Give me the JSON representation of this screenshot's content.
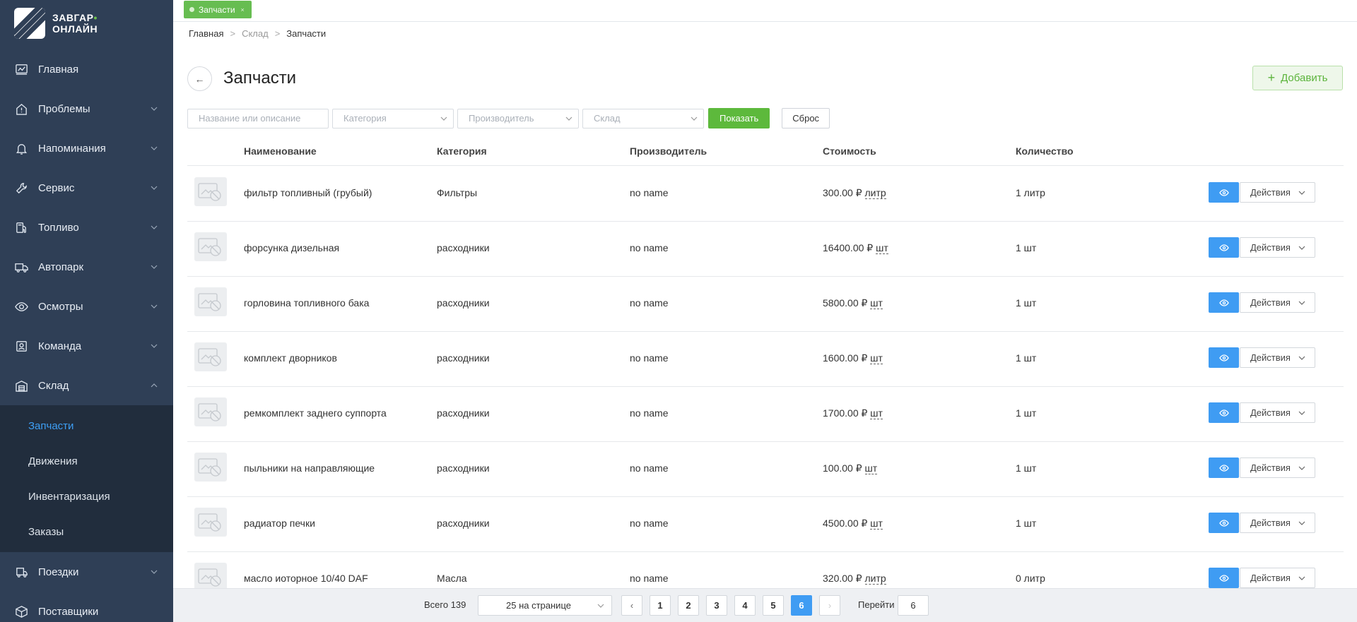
{
  "app": {
    "logo_line1": "ЗАВГАР",
    "logo_line2": "ОНЛАЙН",
    "accent_color": "#5db93c",
    "primary_color": "#3f9cf3",
    "sidebar_color": "#2f3f56"
  },
  "sidebar": {
    "items": [
      {
        "label": "Главная",
        "icon": "dashboard-icon"
      },
      {
        "label": "Проблемы",
        "icon": "alert-house-icon"
      },
      {
        "label": "Напоминания",
        "icon": "bell-icon"
      },
      {
        "label": "Сервис",
        "icon": "wrench-icon"
      },
      {
        "label": "Топливо",
        "icon": "fuel-pump-icon"
      },
      {
        "label": "Автопарк",
        "icon": "truck-icon"
      },
      {
        "label": "Осмотры",
        "icon": "eye-icon"
      },
      {
        "label": "Команда",
        "icon": "id-badge-icon"
      },
      {
        "label": "Склад",
        "icon": "warehouse-icon"
      }
    ],
    "sub_items": [
      {
        "label": "Запчасти",
        "active": true
      },
      {
        "label": "Движения"
      },
      {
        "label": "Инвентаризация"
      },
      {
        "label": "Заказы"
      }
    ],
    "items_after": [
      {
        "label": "Поездки",
        "icon": "route-icon"
      },
      {
        "label": "Поставщики",
        "icon": "box-icon"
      }
    ]
  },
  "topbar": {
    "tab_label": "Запчасти"
  },
  "breadcrumb": [
    "Главная",
    "Склад",
    "Запчасти"
  ],
  "page": {
    "title": "Запчасти",
    "add_label": "Добавить"
  },
  "filters": {
    "search_placeholder": "Название или описание",
    "category_placeholder": "Категория",
    "manufacturer_placeholder": "Производитель",
    "warehouse_placeholder": "Склад",
    "show_label": "Показать",
    "reset_label": "Сброс"
  },
  "table": {
    "columns": [
      "Наименование",
      "Категория",
      "Производитель",
      "Стоимость",
      "Количество"
    ],
    "rows": [
      {
        "name": "фильтр топливный (грубый)",
        "category": "Фильтры",
        "manufacturer": "no name",
        "price": "300.00 ₽",
        "unit": "литр",
        "qty": "1 литр"
      },
      {
        "name": "форсунка дизельная",
        "category": "расходники",
        "manufacturer": "no name",
        "price": "16400.00 ₽",
        "unit": "шт",
        "qty": "1 шт"
      },
      {
        "name": "горловина топливного бака",
        "category": "расходники",
        "manufacturer": "no name",
        "price": "5800.00 ₽",
        "unit": "шт",
        "qty": "1 шт"
      },
      {
        "name": "комплект дворников",
        "category": "расходники",
        "manufacturer": "no name",
        "price": "1600.00 ₽",
        "unit": "шт",
        "qty": "1 шт"
      },
      {
        "name": "ремкомплект заднего суппорта",
        "category": "расходники",
        "manufacturer": "no name",
        "price": "1700.00 ₽",
        "unit": "шт",
        "qty": "1 шт"
      },
      {
        "name": "пыльники на направляющие",
        "category": "расходники",
        "manufacturer": "no name",
        "price": "100.00 ₽",
        "unit": "шт",
        "qty": "1 шт"
      },
      {
        "name": "радиатор печки",
        "category": "расходники",
        "manufacturer": "no name",
        "price": "4500.00 ₽",
        "unit": "шт",
        "qty": "1 шт"
      },
      {
        "name": "масло иоторное 10/40 DAF",
        "category": "Масла",
        "manufacturer": "no name",
        "price": "320.00 ₽",
        "unit": "литр",
        "qty": "0 литр"
      }
    ],
    "actions_label": "Действия"
  },
  "pager": {
    "total": "Всего 139",
    "page_size": "25 на странице",
    "pages": [
      "1",
      "2",
      "3",
      "4",
      "5",
      "6"
    ],
    "current": "6",
    "prev": "‹",
    "next": "›",
    "goto_label": "Перейти",
    "goto_value": "6"
  }
}
